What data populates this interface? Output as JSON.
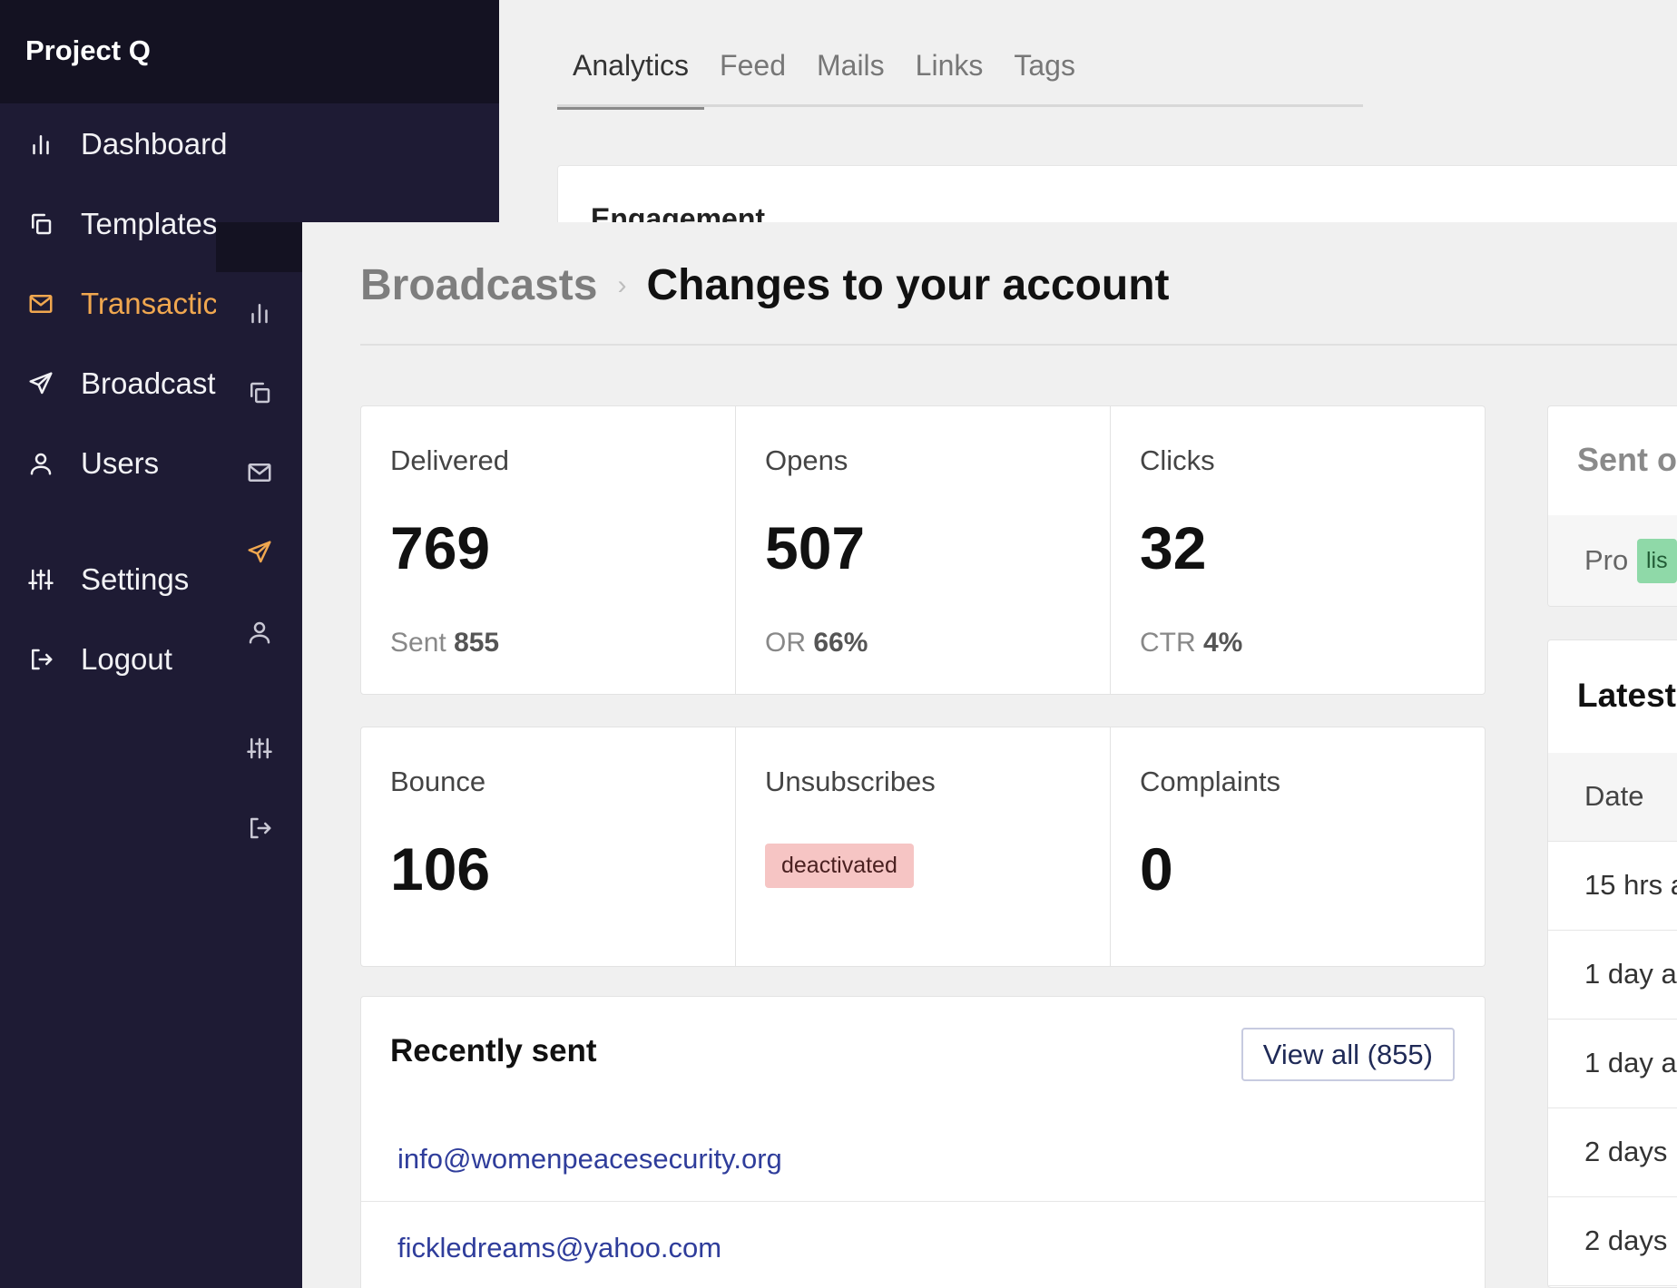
{
  "app": {
    "name": "Project Q"
  },
  "sidebar": {
    "items": [
      {
        "label": "Dashboard",
        "icon": "bar-chart-icon"
      },
      {
        "label": "Templates",
        "icon": "copy-icon"
      },
      {
        "label": "Transactic",
        "icon": "mail-icon",
        "active": true
      },
      {
        "label": "Broadcast",
        "icon": "send-icon"
      },
      {
        "label": "Users",
        "icon": "user-icon"
      },
      {
        "label": "Settings",
        "icon": "sliders-icon"
      },
      {
        "label": "Logout",
        "icon": "logout-icon"
      }
    ]
  },
  "back_window": {
    "tabs": [
      {
        "label": "Analytics",
        "active": true
      },
      {
        "label": "Feed"
      },
      {
        "label": "Mails"
      },
      {
        "label": "Links"
      },
      {
        "label": "Tags"
      }
    ],
    "card_title": "Engagement"
  },
  "front_window": {
    "breadcrumb": {
      "parent": "Broadcasts",
      "separator": "›",
      "current": "Changes to your account"
    },
    "stats_row1": [
      {
        "label": "Delivered",
        "value": "769",
        "sub_label": "Sent",
        "sub_value": "855"
      },
      {
        "label": "Opens",
        "value": "507",
        "sub_label": "OR",
        "sub_value": "66%"
      },
      {
        "label": "Clicks",
        "value": "32",
        "sub_label": "CTR",
        "sub_value": "4%"
      }
    ],
    "stats_row2": [
      {
        "label": "Bounce",
        "value": "106"
      },
      {
        "label": "Unsubscribes",
        "badge": "deactivated"
      },
      {
        "label": "Complaints",
        "value": "0"
      }
    ],
    "recent": {
      "title": "Recently sent",
      "view_all": "View all (855)",
      "emails": [
        "info@womenpeacesecurity.org",
        "fickledreams@yahoo.com"
      ]
    },
    "sent_card": {
      "title": "Sent o",
      "pro_label": "Pro",
      "tag": "lis"
    },
    "latest": {
      "title": "Latest",
      "column": "Date",
      "rows": [
        "15 hrs a",
        "1 day a",
        "1 day a",
        "2 days",
        "2 days"
      ]
    }
  },
  "colors": {
    "sidebar_bg": "#1e1b34",
    "sidebar_header_bg": "#141222",
    "accent": "#f0a74f",
    "link": "#2f3d9b",
    "danger_badge": "#f6c5c4",
    "success_tag": "#8fd9a8"
  }
}
